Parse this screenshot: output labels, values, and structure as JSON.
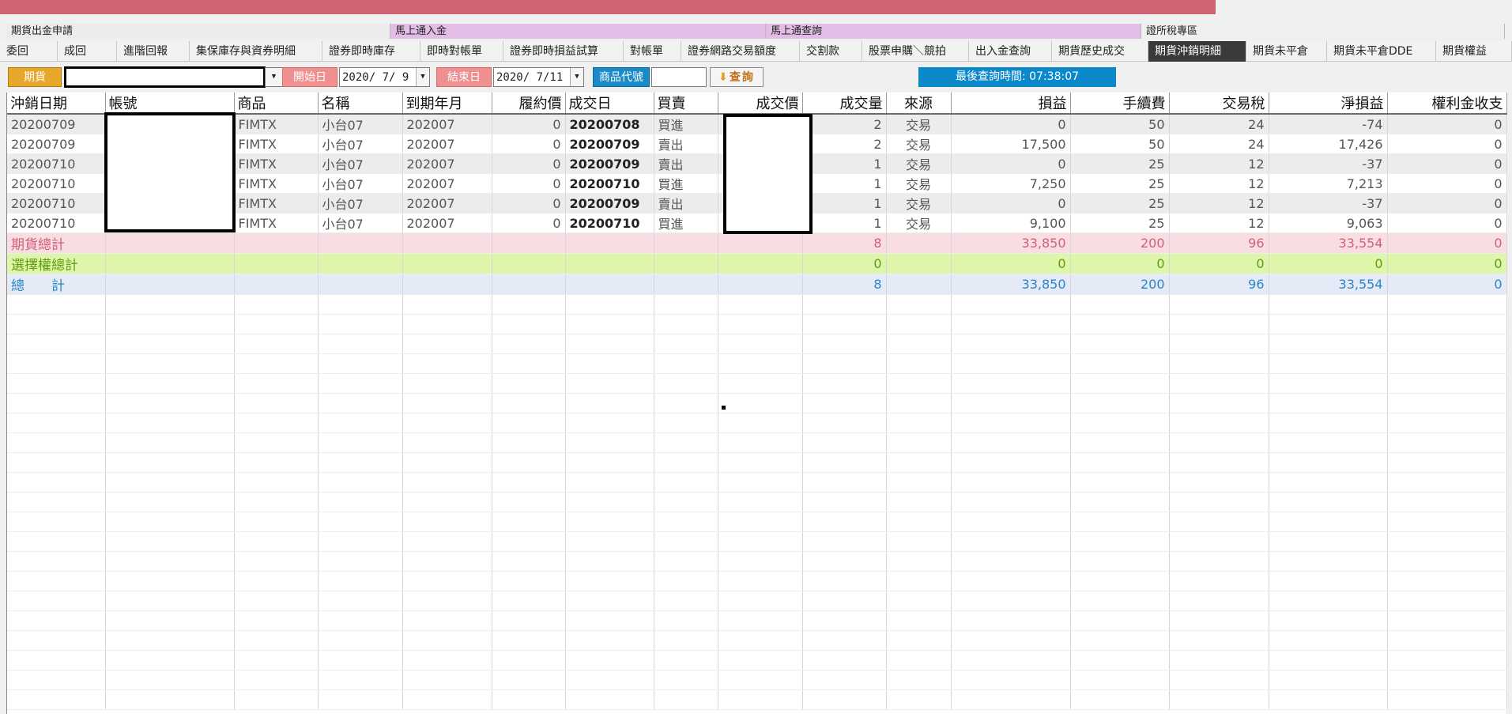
{
  "sections": [
    "期貨出金申請",
    "馬上通入金",
    "馬上通查詢",
    "證所稅專區"
  ],
  "tabs": [
    "委回",
    "成回",
    "進階回報",
    "集保庫存與資券明細",
    "證券即時庫存",
    "即時對帳單",
    "證券即時損益試算",
    "對帳單",
    "證券網路交易額度",
    "交割款",
    "股票申購＼競拍",
    "出入金查詢",
    "期貨歷史成交",
    "期貨沖銷明細",
    "期貨未平倉",
    "期貨未平倉DDE",
    "期貨權益"
  ],
  "active_tab": "期貨沖銷明細",
  "toolbar": {
    "market_label": "期貨",
    "account_value": "",
    "start_label": "開始日",
    "start_date": "2020/ 7/ 9",
    "end_label": "結束日",
    "end_date": "2020/ 7/11",
    "product_label": "商品代號",
    "product_value": "",
    "query_button": "查詢",
    "last_query": "最後查詢時間: 07:38:07"
  },
  "colors": {
    "top_bar": "#cf6374",
    "accent_orange": "#e7a72b",
    "accent_pink": "#f08f8f",
    "accent_blue": "#1a8bc8"
  },
  "table": {
    "columns": [
      "沖銷日期",
      "帳號",
      "商品",
      "名稱",
      "到期年月",
      "履約價",
      "成交日",
      "買賣",
      "成交價",
      "成交量",
      "來源",
      "損益",
      "手續費",
      "交易稅",
      "淨損益",
      "權利金收支"
    ],
    "rows": [
      [
        "20200709",
        "",
        "FIMTX",
        "小台07",
        "202007",
        "0",
        "20200708",
        "買進",
        "",
        "2",
        "交易",
        "0",
        "50",
        "24",
        "-74",
        "0"
      ],
      [
        "20200709",
        "",
        "FIMTX",
        "小台07",
        "202007",
        "0",
        "20200709",
        "賣出",
        "",
        "2",
        "交易",
        "17,500",
        "50",
        "24",
        "17,426",
        "0"
      ],
      [
        "20200710",
        "",
        "FIMTX",
        "小台07",
        "202007",
        "0",
        "20200709",
        "賣出",
        "",
        "1",
        "交易",
        "0",
        "25",
        "12",
        "-37",
        "0"
      ],
      [
        "20200710",
        "",
        "FIMTX",
        "小台07",
        "202007",
        "0",
        "20200710",
        "買進",
        "",
        "1",
        "交易",
        "7,250",
        "25",
        "12",
        "7,213",
        "0"
      ],
      [
        "20200710",
        "",
        "FIMTX",
        "小台07",
        "202007",
        "0",
        "20200709",
        "賣出",
        "",
        "1",
        "交易",
        "0",
        "25",
        "12",
        "-37",
        "0"
      ],
      [
        "20200710",
        "",
        "FIMTX",
        "小台07",
        "202007",
        "0",
        "20200710",
        "買進",
        "",
        "1",
        "交易",
        "9,100",
        "25",
        "12",
        "9,063",
        "0"
      ]
    ],
    "summary": [
      {
        "label": "期貨總計",
        "qty": "8",
        "pnl": "33,850",
        "fee": "200",
        "tax": "96",
        "net": "33,554",
        "premium": "0"
      },
      {
        "label": "選擇權總計",
        "qty": "0",
        "pnl": "0",
        "fee": "0",
        "tax": "0",
        "net": "0",
        "premium": "0"
      },
      {
        "label": "總　　計",
        "qty": "8",
        "pnl": "33,850",
        "fee": "200",
        "tax": "96",
        "net": "33,554",
        "premium": "0"
      }
    ]
  }
}
